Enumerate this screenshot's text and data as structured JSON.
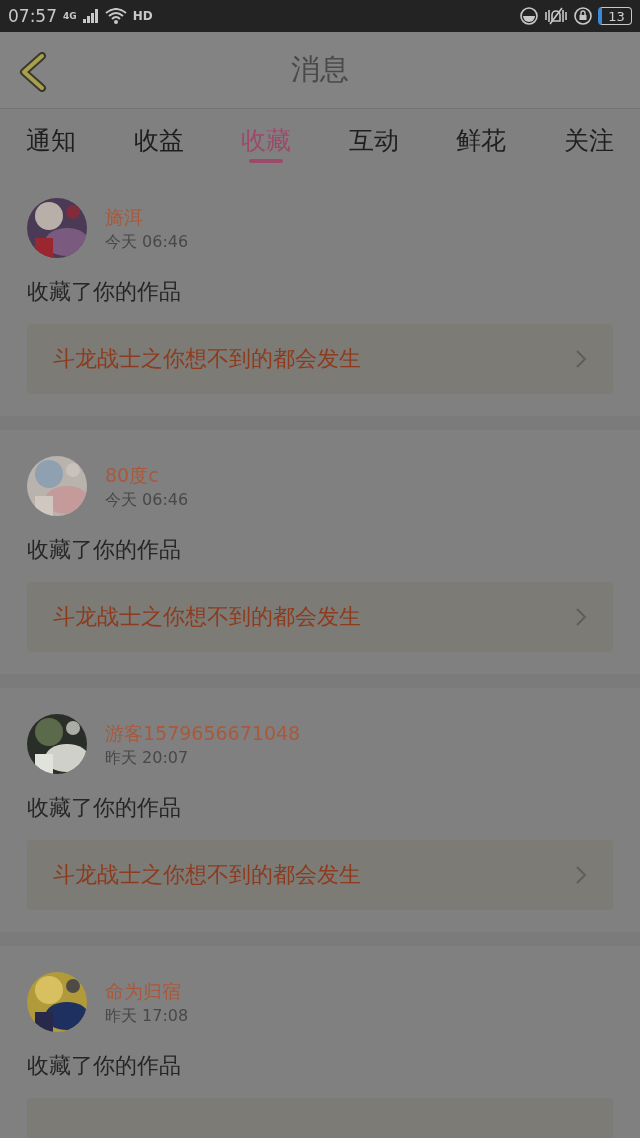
{
  "status_bar": {
    "time": "07:57",
    "network": "4G",
    "hd": "HD",
    "battery": "13"
  },
  "header": {
    "title": "消息"
  },
  "tabs": [
    {
      "label": "通知",
      "selected": false
    },
    {
      "label": "收益",
      "selected": false
    },
    {
      "label": "收藏",
      "selected": true
    },
    {
      "label": "互动",
      "selected": false
    },
    {
      "label": "鲜花",
      "selected": false
    },
    {
      "label": "关注",
      "selected": false
    }
  ],
  "messages": [
    {
      "name": "旖洱",
      "time": "今天 06:46",
      "action": "收藏了你的作品",
      "work_title": "斗龙战士之你想不到的都会发生"
    },
    {
      "name": "80度c",
      "time": "今天 06:46",
      "action": "收藏了你的作品",
      "work_title": "斗龙战士之你想不到的都会发生"
    },
    {
      "name": "游客1579656671048",
      "time": "昨天 20:07",
      "action": "收藏了你的作品",
      "work_title": "斗龙战士之你想不到的都会发生"
    },
    {
      "name": "命为归宿",
      "time": "昨天 17:08",
      "action": "收藏了你的作品"
    }
  ]
}
